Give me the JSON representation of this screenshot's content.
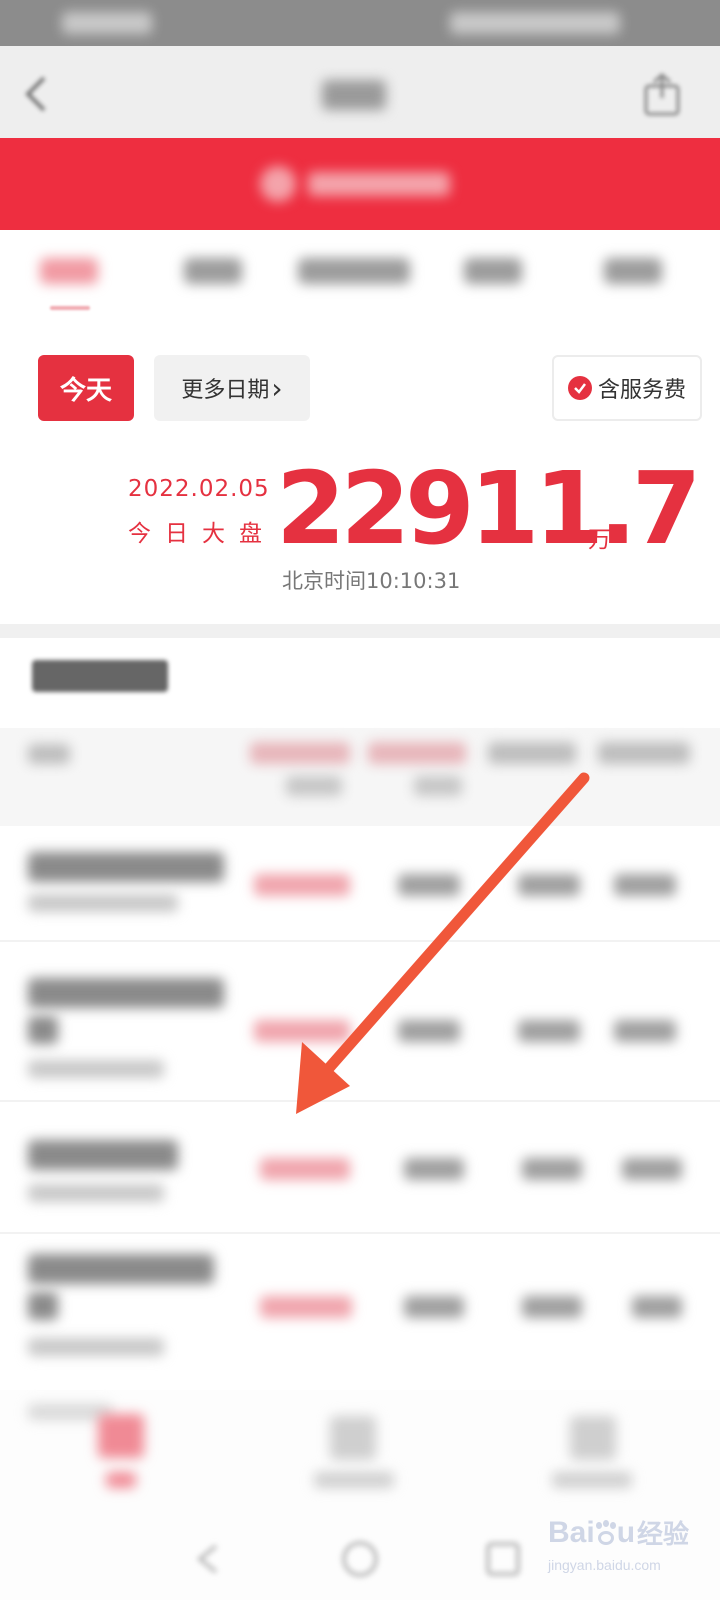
{
  "date_controls": {
    "today_label": "今天",
    "more_dates_label": "更多日期",
    "more_dates_chevron": "›",
    "service_fee_label": "含服务费"
  },
  "summary": {
    "date": "2022.02.05",
    "label": "今日大盘",
    "value": "22911.7",
    "unit": "万",
    "time": "北京时间10:10:31"
  },
  "watermark": {
    "brand": "Bai",
    "brand_tail": "u",
    "brand_cn": "经验",
    "url": "jingyan.baidu.com"
  },
  "colors": {
    "accent": "#e53140",
    "banner": "#ee2e40",
    "annotation_arrow": "#f0573a"
  },
  "icons": {
    "back": "chevron-left-icon",
    "share": "share-icon",
    "check": "check-circle-icon",
    "arrow": "annotation-arrow-icon"
  }
}
